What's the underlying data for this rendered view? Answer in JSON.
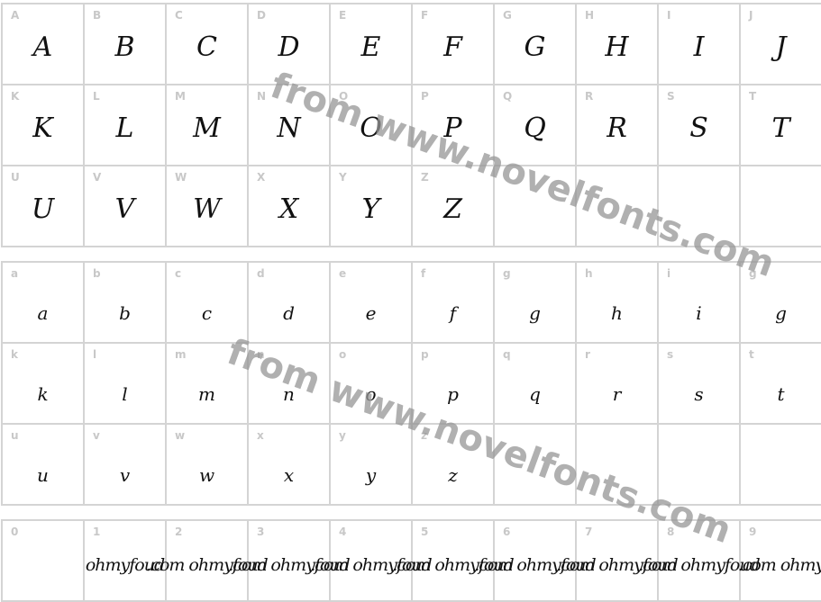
{
  "sections": [
    {
      "name": "uppercase",
      "cells": [
        "A",
        "B",
        "C",
        "D",
        "E",
        "F",
        "G",
        "H",
        "I",
        "J",
        "K",
        "L",
        "M",
        "N",
        "O",
        "P",
        "Q",
        "R",
        "S",
        "T",
        "U",
        "V",
        "W",
        "X",
        "Y",
        "Z",
        "",
        "",
        "",
        ""
      ],
      "glyphs": [
        "A",
        "B",
        "C",
        "D",
        "E",
        "F",
        "G",
        "H",
        "I",
        "J",
        "K",
        "L",
        "M",
        "N",
        "O",
        "P",
        "Q",
        "R",
        "S",
        "T",
        "U",
        "V",
        "W",
        "X",
        "Y",
        "Z",
        "",
        "",
        "",
        ""
      ]
    },
    {
      "name": "lowercase",
      "cells": [
        "a",
        "b",
        "c",
        "d",
        "e",
        "f",
        "g",
        "h",
        "i",
        "g",
        "k",
        "l",
        "m",
        "n",
        "o",
        "p",
        "q",
        "r",
        "s",
        "t",
        "u",
        "v",
        "w",
        "x",
        "y",
        "z",
        "",
        "",
        "",
        ""
      ],
      "glyphs": [
        "a",
        "b",
        "c",
        "d",
        "e",
        "f",
        "g",
        "h",
        "i",
        "g",
        "k",
        "l",
        "m",
        "n",
        "o",
        "p",
        "q",
        "r",
        "s",
        "t",
        "u",
        "v",
        "w",
        "x",
        "y",
        "z",
        "",
        "",
        "",
        ""
      ]
    },
    {
      "name": "digits",
      "cells": [
        "0",
        "1",
        "2",
        "3",
        "4",
        "5",
        "6",
        "7",
        "8",
        "9"
      ],
      "glyphs": [
        "",
        "ohmyfoud",
        ".com ohmyfoud",
        ".com ohmyfoud",
        ".com ohmyfoud",
        ".com ohmyfoud",
        ".com ohmyfoud",
        ".com ohmyfoud",
        ".com ohmyfoud",
        ".com ohmy"
      ]
    }
  ],
  "watermark": "from www.novelfonts.com"
}
